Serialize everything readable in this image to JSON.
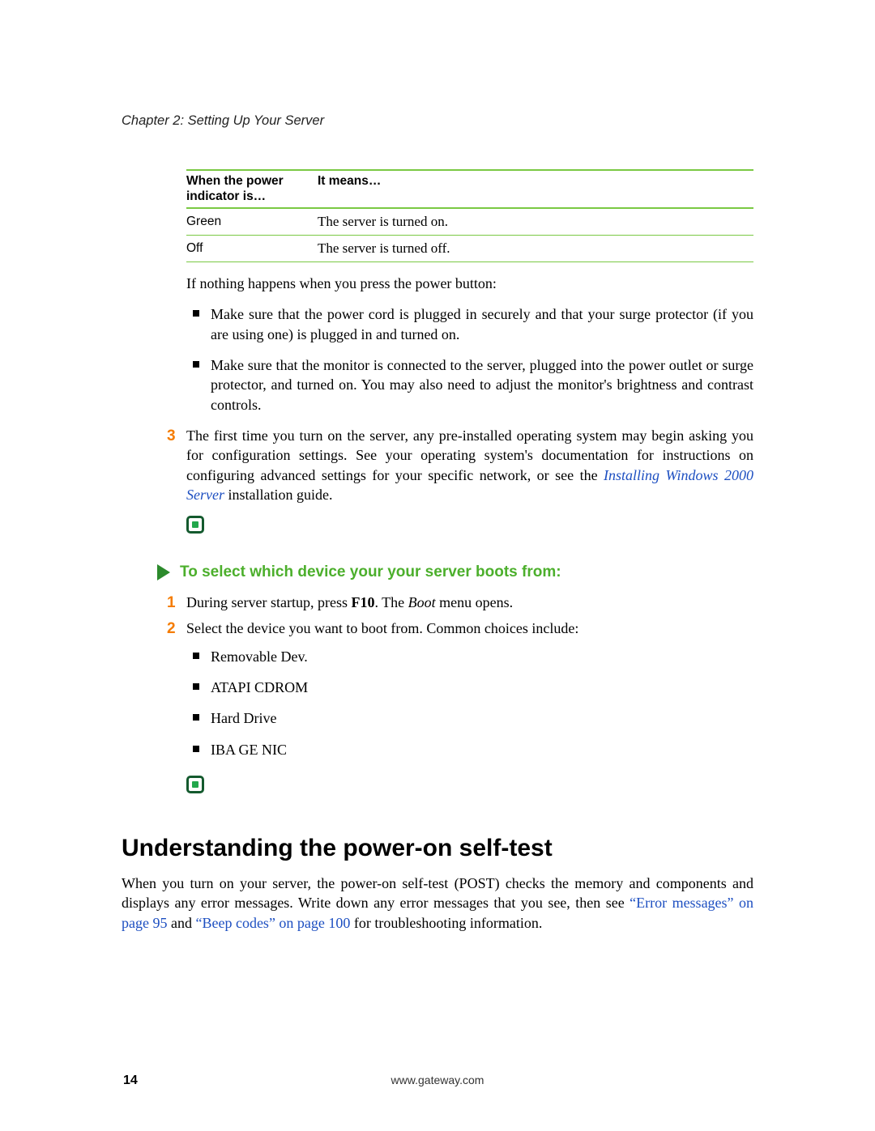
{
  "chapter_header": "Chapter 2: Setting Up Your Server",
  "table": {
    "header_col1_line1": "When the power",
    "header_col1_line2": "indicator is…",
    "header_col2": "It means…",
    "rows": [
      {
        "c1": "Green",
        "c2": "The server is turned on."
      },
      {
        "c1": "Off",
        "c2": "The server is turned off."
      }
    ]
  },
  "intro_after_table": "If nothing happens when you press the power button:",
  "bullets_1": [
    "Make sure that the power cord is plugged in securely and that your surge protector (if you are using one) is plugged in and turned on.",
    "Make sure that the monitor is connected to the server, plugged into the power outlet or surge protector, and turned on. You may also need to adjust the monitor's brightness and contrast controls."
  ],
  "step3": {
    "num": "3",
    "pre": "The first time you turn on the server, any pre-installed operating system may begin asking you for configuration settings. See your operating system's documentation for instructions on configuring advanced settings for your specific network, or see the ",
    "link": "Installing Windows 2000 Server",
    "post": " installation guide."
  },
  "procedure_title": "To select which device your your server boots from:",
  "proc_steps": {
    "s1": {
      "num": "1",
      "pre": "During server startup, press ",
      "key": "F10",
      "mid": ". The ",
      "ital": "Boot",
      "post": " menu opens."
    },
    "s2": {
      "num": "2",
      "text": "Select the device you want to boot from. Common choices include:"
    }
  },
  "boot_choices": [
    "Removable Dev.",
    "ATAPI CDROM",
    "Hard Drive",
    "IBA GE NIC"
  ],
  "heading2": "Understanding the power-on self-test",
  "post_para": {
    "pre": "When you turn on your server, the power-on self-test (POST) checks the memory and components and displays any error messages. Write down any error messages that you see, then see ",
    "link1": "“Error messages” on page 95",
    "mid": " and ",
    "link2": "“Beep codes” on page 100",
    "post": " for troubleshooting information."
  },
  "footer_url": "www.gateway.com",
  "page_number": "14"
}
